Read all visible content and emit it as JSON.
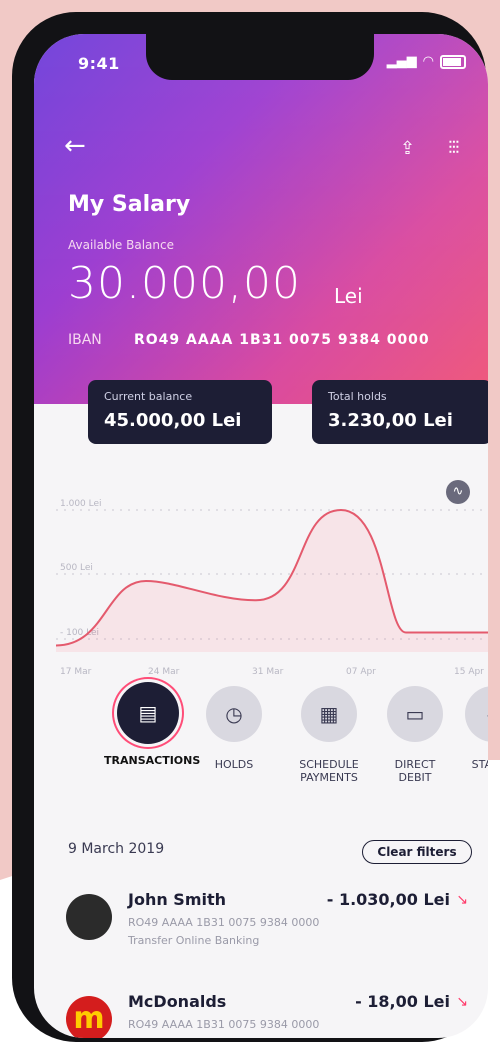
{
  "status_bar": {
    "time": "9:41"
  },
  "header": {
    "title": "My Salary",
    "available_label": "Available Balance",
    "available_amount": "30.000,00",
    "currency": "Lei",
    "iban_label": "IBAN",
    "iban": "RO49 AAAA 1B31 0075 9384 0000"
  },
  "cards": [
    {
      "label": "Current balance",
      "value": "45.000,00 Lei"
    },
    {
      "label": "Total holds",
      "value": "3.230,00 Lei"
    }
  ],
  "chart_data": {
    "type": "area",
    "x": [
      "17 Mar",
      "24 Mar",
      "31 Mar",
      "07 Apr",
      "15 Apr"
    ],
    "y_ticks": [
      "1.000 Lei",
      "500 Lei",
      "- 100 Lei"
    ],
    "series": [
      {
        "values": [
          -50,
          450,
          300,
          1000,
          50,
          50
        ]
      }
    ]
  },
  "actions": [
    {
      "label": "TRANSACTIONS",
      "icon": "transactions-icon"
    },
    {
      "label": "HOLDS",
      "icon": "holds-icon"
    },
    {
      "label": "SCHEDULE PAYMENTS",
      "icon": "schedule-icon"
    },
    {
      "label": "DIRECT DEBIT",
      "icon": "direct-debit-icon"
    },
    {
      "label": "STATEM",
      "icon": "statement-icon"
    }
  ],
  "filters": {
    "date": "9 March 2019",
    "clear_label": "Clear filters"
  },
  "transactions": [
    {
      "name": "John Smith",
      "amount": "- 1.030,00 Lei",
      "iban": "RO49 AAAA 1B31 0075 9384 0000",
      "note": "Transfer Online Banking"
    },
    {
      "name": "McDonalds",
      "amount": "- 18,00 Lei",
      "iban": "RO49 AAAA 1B31 0075 9384 0000",
      "note": ""
    }
  ],
  "colors": {
    "accent": "#ff4d78",
    "navy": "#1d1e35"
  }
}
